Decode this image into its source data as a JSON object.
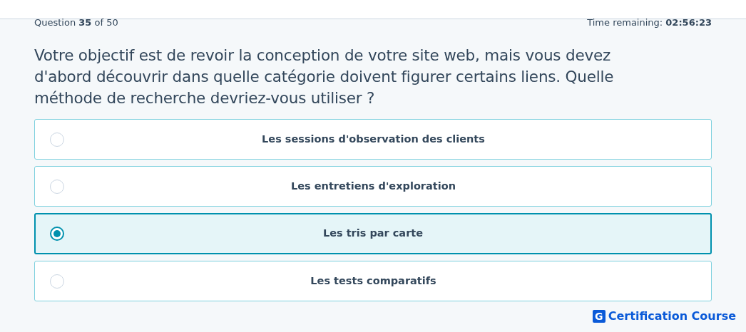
{
  "progress": "Question **35** of 50",
  "timer": "Time remaining: **02:56:23**",
  "question": "Votre objectif est de revoir la conception de votre site web, mais vous devez d'abord découvrir dans quelle catégorie doivent figurer certains liens. Quelle méthode de recherche devriez-vous utiliser ?",
  "options": [
    {
      "label": "Les sessions d'observation des clients",
      "selected": false
    },
    {
      "label": "Les entretiens d'exploration",
      "selected": false
    },
    {
      "label": "Les tris par carte",
      "selected": true
    },
    {
      "label": "Les tests comparatifs",
      "selected": false
    }
  ],
  "brand": {
    "mark": "G",
    "name": "Certification Course"
  }
}
